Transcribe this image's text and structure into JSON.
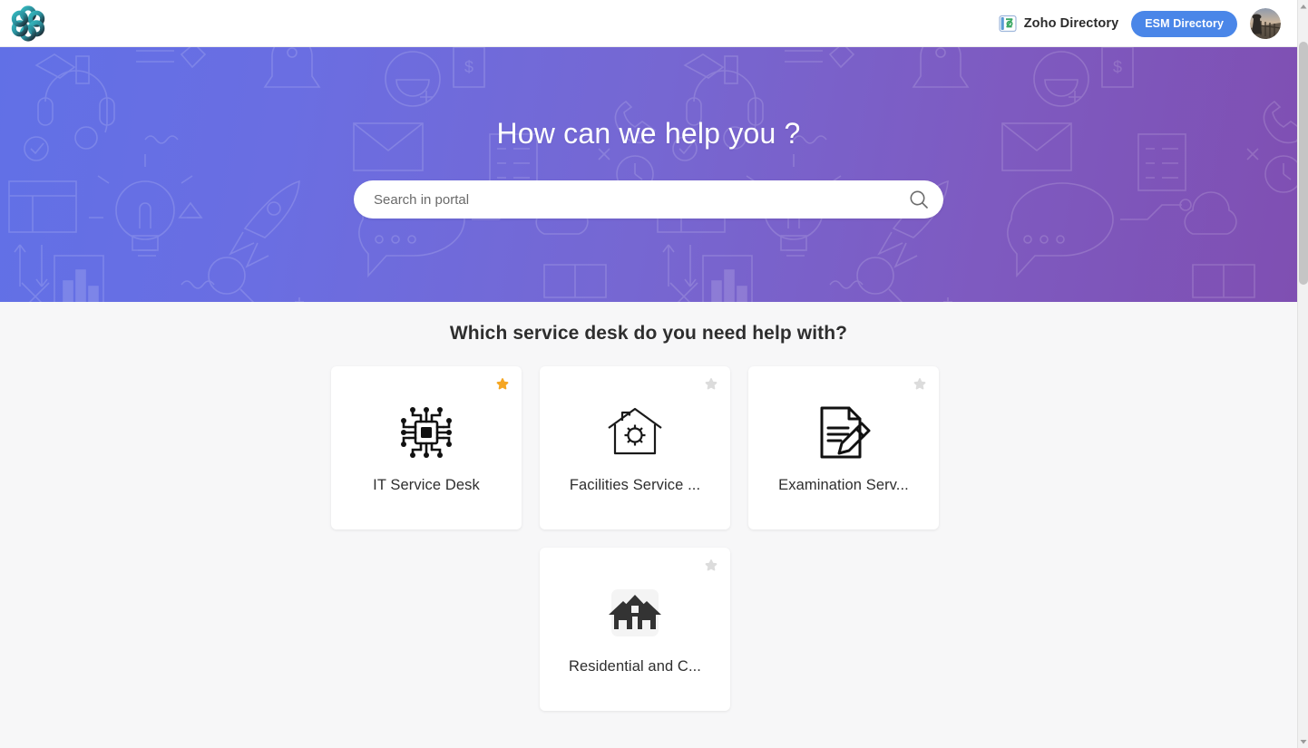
{
  "topbar": {
    "logo_name": "esm-portal-logo",
    "zoho_directory_label": "Zoho Directory",
    "zoho_directory_icon": "zoho-directory-icon",
    "esm_button_label": "ESM Directory",
    "avatar_name": "user-avatar",
    "esm_button_color": "#4a86e8"
  },
  "hero": {
    "title": "How can we help you ?",
    "search_placeholder": "Search in portal",
    "search_value": "",
    "search_icon": "search-icon",
    "gradient_from": "#6170e6",
    "gradient_to": "#7f4fb2"
  },
  "main": {
    "section_title": "Which service desk do you need help with?",
    "cards": [
      {
        "label": "IT Service Desk",
        "icon": "microchip-icon",
        "favorited": true,
        "star_color": "#f5a623"
      },
      {
        "label": "Facilities Service ...",
        "icon": "house-gear-icon",
        "favorited": false,
        "star_color": "#dcdcdc"
      },
      {
        "label": "Examination Serv...",
        "icon": "document-pencil-icon",
        "favorited": false,
        "star_color": "#dcdcdc"
      },
      {
        "label": "Residential and C...",
        "icon": "two-houses-icon",
        "favorited": false,
        "star_color": "#dcdcdc"
      }
    ]
  },
  "scrollbar": {
    "name": "vertical-scrollbar"
  }
}
